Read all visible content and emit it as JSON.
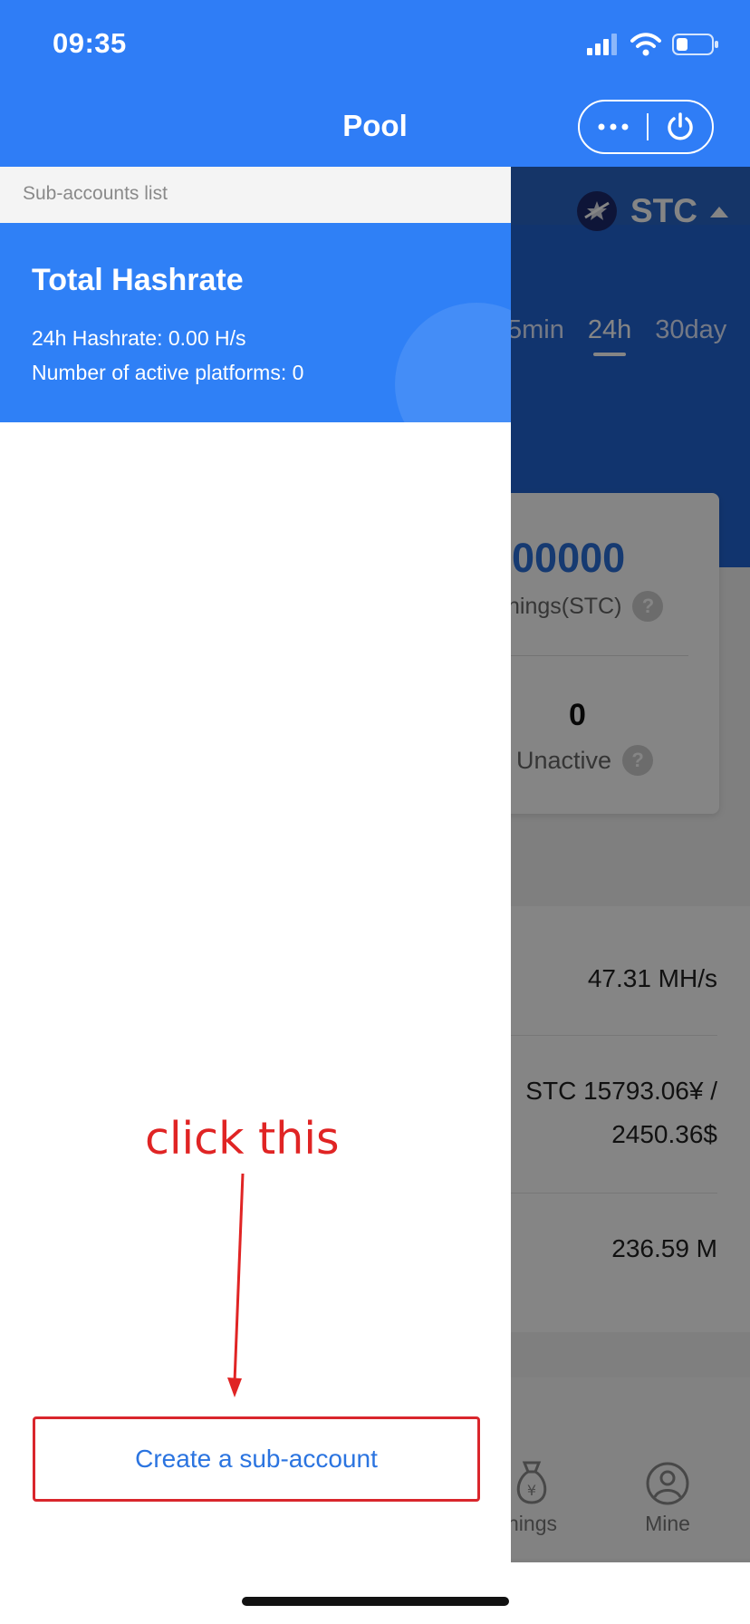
{
  "status_bar": {
    "time": "09:35"
  },
  "nav": {
    "title": "Pool",
    "more_icon": "ellipsis-icon",
    "power_icon": "power-icon"
  },
  "background_page": {
    "coin": {
      "symbol": "STC"
    },
    "tabs": [
      "5min",
      "24h",
      "30day"
    ],
    "active_tab": "24h",
    "earnings_value": "000000",
    "earnings_label": "nings(STC)",
    "unactive_value": "0",
    "unactive_label": "Unactive",
    "help_mark": "?",
    "rows": [
      {
        "value": "47.31 MH/s"
      },
      {
        "value_line1": "STC 15793.06¥ /",
        "value_line2": "2450.36$"
      },
      {
        "value": "236.59 M"
      }
    ],
    "tabbar": {
      "earnings_label": "nings",
      "mine_label": "Mine"
    }
  },
  "drawer": {
    "header_label": "Sub-accounts list",
    "total_card": {
      "title": "Total Hashrate",
      "hashrate_line": "24h Hashrate: 0.00 H/s",
      "platforms_line": "Number of active platforms: 0"
    },
    "create_button_label": "Create a sub-account"
  },
  "annotation": {
    "text": "click this",
    "color": "#e02424"
  },
  "colors": {
    "primary": "#2f7df6",
    "card_blue": "#2f80f6",
    "button_text": "#2b74e0",
    "highlight_border": "#d9262c"
  }
}
